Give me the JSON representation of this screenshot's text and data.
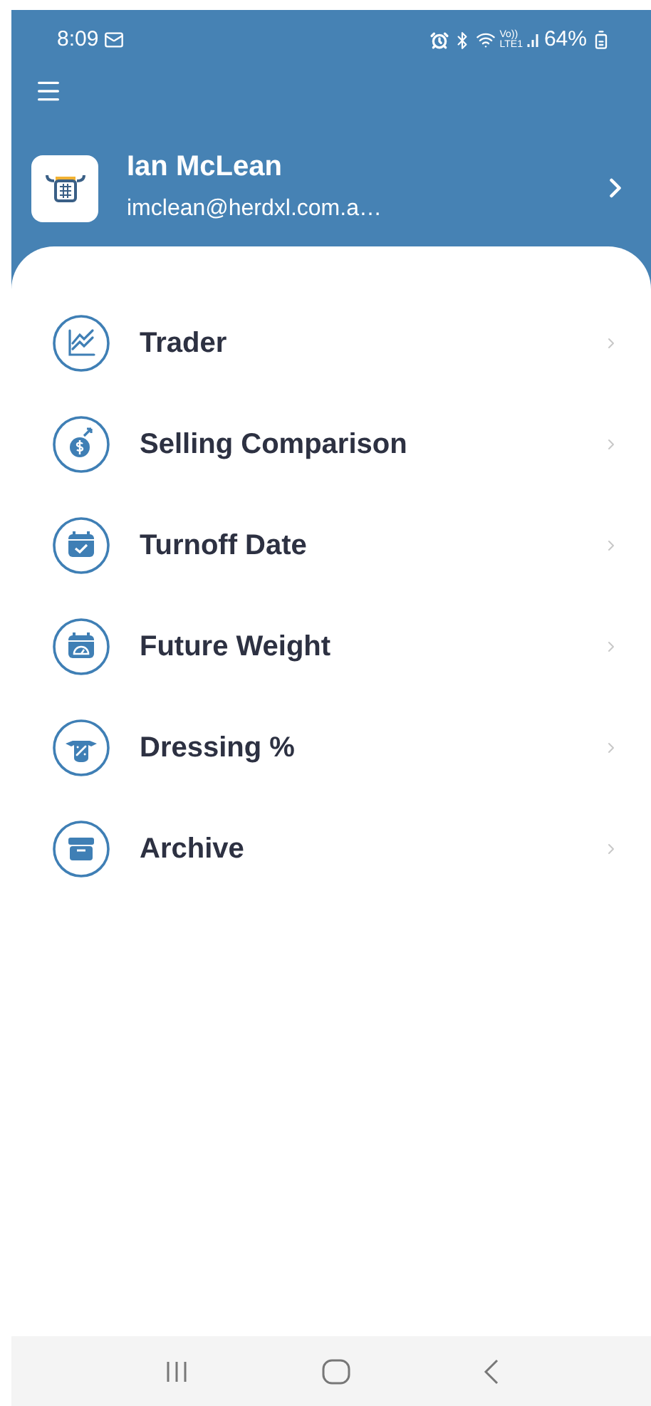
{
  "status_bar": {
    "time": "8:09",
    "network_top": "Vo))",
    "network_bottom": "LTE1",
    "battery": "64%"
  },
  "profile": {
    "name": "Ian McLean",
    "email": "imclean@herdxl.com.a…"
  },
  "menu": [
    {
      "label": "Trader",
      "kind": "chart"
    },
    {
      "label": "Selling Comparison",
      "kind": "money"
    },
    {
      "label": "Turnoff Date",
      "kind": "calendar-check"
    },
    {
      "label": "Future Weight",
      "kind": "calendar-gauge"
    },
    {
      "label": "Dressing %",
      "kind": "carcass"
    },
    {
      "label": "Archive",
      "kind": "archive"
    }
  ]
}
